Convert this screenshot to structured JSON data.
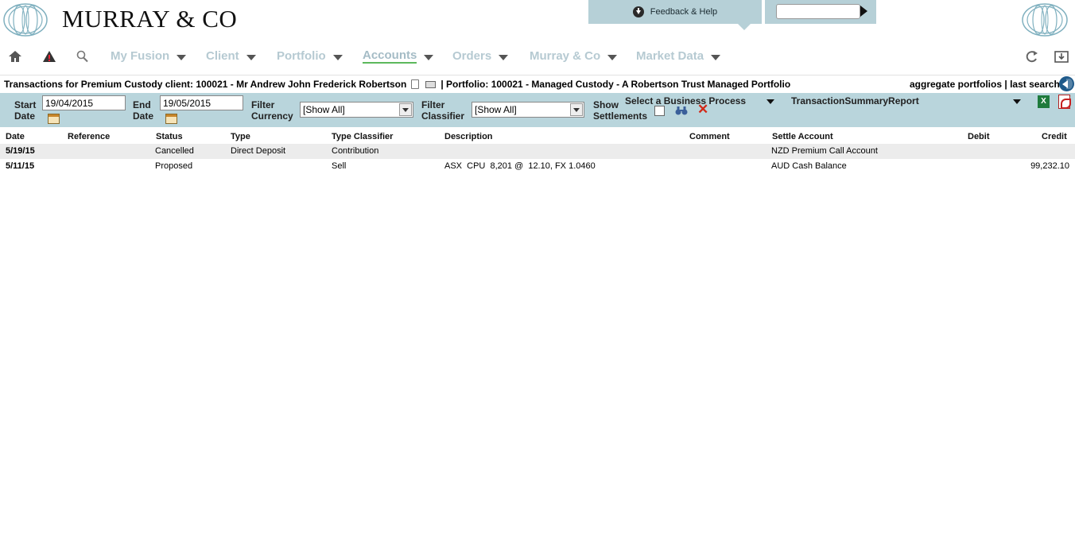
{
  "brand": "MURRAY & CO",
  "feedback_label": "Feedback & Help",
  "search": {
    "value": ""
  },
  "nav": {
    "items": [
      "My Fusion",
      "Client",
      "Portfolio",
      "Accounts",
      "Orders",
      "Murray & Co",
      "Market Data"
    ],
    "active": "Accounts"
  },
  "title": {
    "client": "Transactions for Premium Custody client: 100021 - Mr Andrew John Frederick Robertson",
    "portfolio": "| Portfolio: 100021 - Managed Custody - A Robertson Trust Managed Portfolio"
  },
  "links": {
    "aggregate": "aggregate portfolios",
    "separator": "|",
    "last_search": "last search"
  },
  "filters": {
    "start_label_1": "Start",
    "start_label_2": "Date",
    "start_date": "19/04/2015",
    "end_label_1": "End",
    "end_label_2": "Date",
    "end_date": "19/05/2015",
    "currency_label_1": "Filter",
    "currency_label_2": "Currency",
    "currency_value": "[Show All]",
    "classifier_label_1": "Filter",
    "classifier_label_2": "Classifier",
    "classifier_value": "[Show All]",
    "settlements_label_1": "Show",
    "settlements_label_2": "Settlements",
    "business_process": "Select a Business Process",
    "report": "TransactionSummaryReport"
  },
  "table": {
    "headers": [
      "Date",
      "Reference",
      "Status",
      "Type",
      "Type Classifier",
      "Description",
      "Comment",
      "Settle Account",
      "Debit",
      "Credit"
    ],
    "rows": [
      [
        "5/19/15",
        "",
        "Cancelled",
        "Direct Deposit",
        "Contribution",
        "",
        "",
        "NZD Premium Call Account",
        "",
        ""
      ],
      [
        "5/11/15",
        "",
        "Proposed",
        "",
        "Sell",
        "ASX  CPU  8,201 @  12.10, FX 1.0460",
        "",
        "AUD Cash Balance",
        "",
        "99,232.10"
      ]
    ]
  }
}
